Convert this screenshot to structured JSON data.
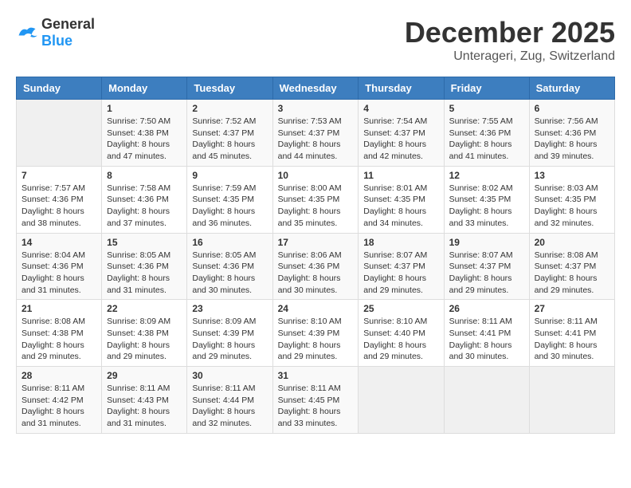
{
  "header": {
    "logo_general": "General",
    "logo_blue": "Blue",
    "month_year": "December 2025",
    "location": "Unterageri, Zug, Switzerland"
  },
  "weekdays": [
    "Sunday",
    "Monday",
    "Tuesday",
    "Wednesday",
    "Thursday",
    "Friday",
    "Saturday"
  ],
  "weeks": [
    [
      {
        "day": "",
        "content": ""
      },
      {
        "day": "1",
        "content": "Sunrise: 7:50 AM\nSunset: 4:38 PM\nDaylight: 8 hours\nand 47 minutes."
      },
      {
        "day": "2",
        "content": "Sunrise: 7:52 AM\nSunset: 4:37 PM\nDaylight: 8 hours\nand 45 minutes."
      },
      {
        "day": "3",
        "content": "Sunrise: 7:53 AM\nSunset: 4:37 PM\nDaylight: 8 hours\nand 44 minutes."
      },
      {
        "day": "4",
        "content": "Sunrise: 7:54 AM\nSunset: 4:37 PM\nDaylight: 8 hours\nand 42 minutes."
      },
      {
        "day": "5",
        "content": "Sunrise: 7:55 AM\nSunset: 4:36 PM\nDaylight: 8 hours\nand 41 minutes."
      },
      {
        "day": "6",
        "content": "Sunrise: 7:56 AM\nSunset: 4:36 PM\nDaylight: 8 hours\nand 39 minutes."
      }
    ],
    [
      {
        "day": "7",
        "content": "Sunrise: 7:57 AM\nSunset: 4:36 PM\nDaylight: 8 hours\nand 38 minutes."
      },
      {
        "day": "8",
        "content": "Sunrise: 7:58 AM\nSunset: 4:36 PM\nDaylight: 8 hours\nand 37 minutes."
      },
      {
        "day": "9",
        "content": "Sunrise: 7:59 AM\nSunset: 4:35 PM\nDaylight: 8 hours\nand 36 minutes."
      },
      {
        "day": "10",
        "content": "Sunrise: 8:00 AM\nSunset: 4:35 PM\nDaylight: 8 hours\nand 35 minutes."
      },
      {
        "day": "11",
        "content": "Sunrise: 8:01 AM\nSunset: 4:35 PM\nDaylight: 8 hours\nand 34 minutes."
      },
      {
        "day": "12",
        "content": "Sunrise: 8:02 AM\nSunset: 4:35 PM\nDaylight: 8 hours\nand 33 minutes."
      },
      {
        "day": "13",
        "content": "Sunrise: 8:03 AM\nSunset: 4:35 PM\nDaylight: 8 hours\nand 32 minutes."
      }
    ],
    [
      {
        "day": "14",
        "content": "Sunrise: 8:04 AM\nSunset: 4:36 PM\nDaylight: 8 hours\nand 31 minutes."
      },
      {
        "day": "15",
        "content": "Sunrise: 8:05 AM\nSunset: 4:36 PM\nDaylight: 8 hours\nand 31 minutes."
      },
      {
        "day": "16",
        "content": "Sunrise: 8:05 AM\nSunset: 4:36 PM\nDaylight: 8 hours\nand 30 minutes."
      },
      {
        "day": "17",
        "content": "Sunrise: 8:06 AM\nSunset: 4:36 PM\nDaylight: 8 hours\nand 30 minutes."
      },
      {
        "day": "18",
        "content": "Sunrise: 8:07 AM\nSunset: 4:37 PM\nDaylight: 8 hours\nand 29 minutes."
      },
      {
        "day": "19",
        "content": "Sunrise: 8:07 AM\nSunset: 4:37 PM\nDaylight: 8 hours\nand 29 minutes."
      },
      {
        "day": "20",
        "content": "Sunrise: 8:08 AM\nSunset: 4:37 PM\nDaylight: 8 hours\nand 29 minutes."
      }
    ],
    [
      {
        "day": "21",
        "content": "Sunrise: 8:08 AM\nSunset: 4:38 PM\nDaylight: 8 hours\nand 29 minutes."
      },
      {
        "day": "22",
        "content": "Sunrise: 8:09 AM\nSunset: 4:38 PM\nDaylight: 8 hours\nand 29 minutes."
      },
      {
        "day": "23",
        "content": "Sunrise: 8:09 AM\nSunset: 4:39 PM\nDaylight: 8 hours\nand 29 minutes."
      },
      {
        "day": "24",
        "content": "Sunrise: 8:10 AM\nSunset: 4:39 PM\nDaylight: 8 hours\nand 29 minutes."
      },
      {
        "day": "25",
        "content": "Sunrise: 8:10 AM\nSunset: 4:40 PM\nDaylight: 8 hours\nand 29 minutes."
      },
      {
        "day": "26",
        "content": "Sunrise: 8:11 AM\nSunset: 4:41 PM\nDaylight: 8 hours\nand 30 minutes."
      },
      {
        "day": "27",
        "content": "Sunrise: 8:11 AM\nSunset: 4:41 PM\nDaylight: 8 hours\nand 30 minutes."
      }
    ],
    [
      {
        "day": "28",
        "content": "Sunrise: 8:11 AM\nSunset: 4:42 PM\nDaylight: 8 hours\nand 31 minutes."
      },
      {
        "day": "29",
        "content": "Sunrise: 8:11 AM\nSunset: 4:43 PM\nDaylight: 8 hours\nand 31 minutes."
      },
      {
        "day": "30",
        "content": "Sunrise: 8:11 AM\nSunset: 4:44 PM\nDaylight: 8 hours\nand 32 minutes."
      },
      {
        "day": "31",
        "content": "Sunrise: 8:11 AM\nSunset: 4:45 PM\nDaylight: 8 hours\nand 33 minutes."
      },
      {
        "day": "",
        "content": ""
      },
      {
        "day": "",
        "content": ""
      },
      {
        "day": "",
        "content": ""
      }
    ]
  ]
}
